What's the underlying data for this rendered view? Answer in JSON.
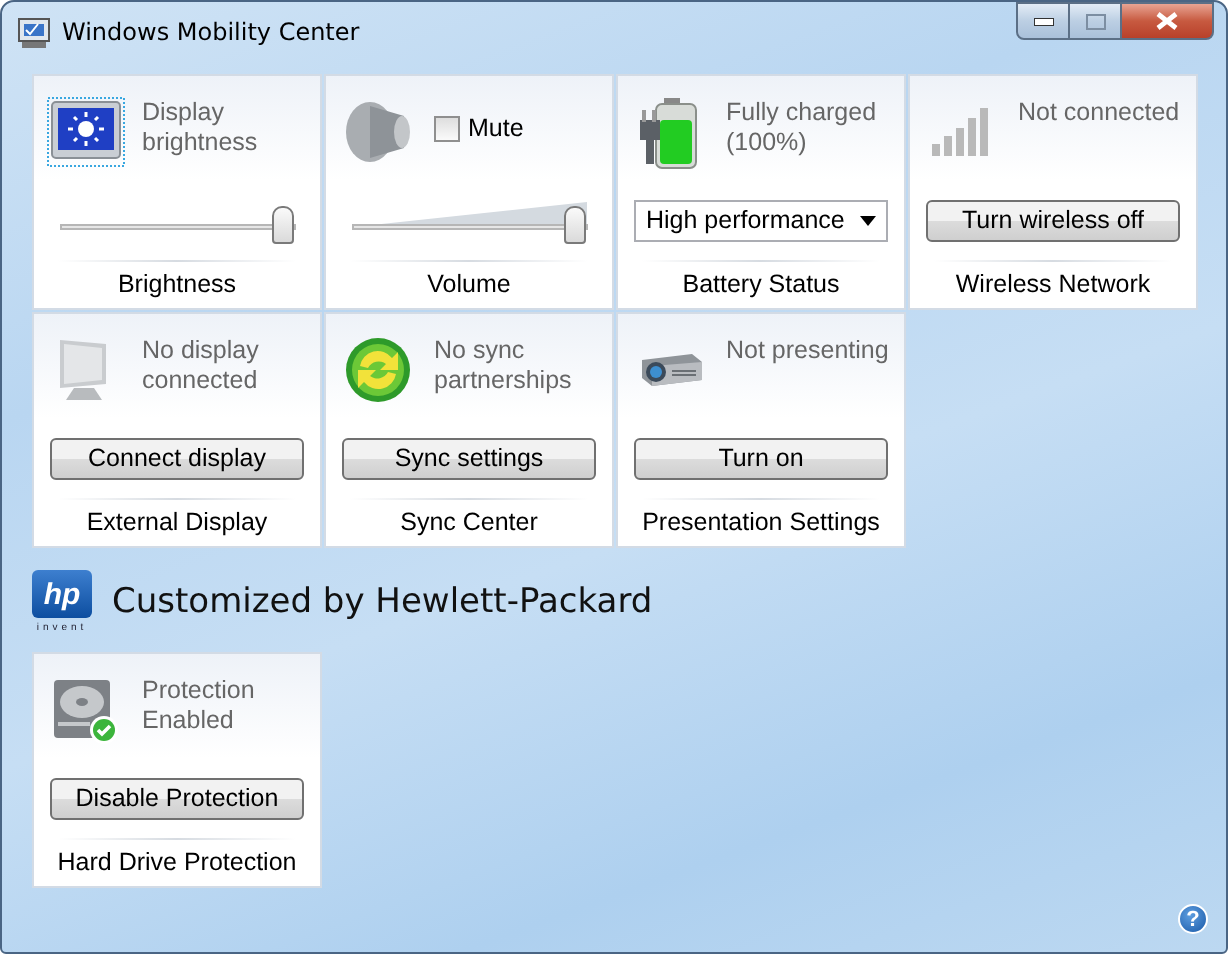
{
  "window": {
    "title": "Windows Mobility Center"
  },
  "tiles": [
    {
      "status": "Display brightness",
      "kind": "slider",
      "level": 1.0,
      "title": "Brightness"
    },
    {
      "kind": "volume",
      "mute": {
        "label": "Mute",
        "checked": false
      },
      "level": 1.0,
      "title": "Volume"
    },
    {
      "status": "Fully charged (100%)",
      "kind": "dropdown",
      "value": "High performance",
      "title": "Battery Status"
    },
    {
      "status": "Not connected",
      "kind": "button",
      "button": "Turn wireless off",
      "title": "Wireless Network"
    },
    {
      "status": "No display connected",
      "kind": "button",
      "button": "Connect display",
      "title": "External Display"
    },
    {
      "status": "No sync partnerships",
      "kind": "button",
      "button": "Sync settings",
      "title": "Sync Center"
    },
    {
      "status": "Not presenting",
      "kind": "button",
      "button": "Turn on",
      "title": "Presentation Settings"
    }
  ],
  "oem": {
    "logo": "hp",
    "tagline": "invent",
    "title": "Customized by Hewlett-Packard",
    "tiles": [
      {
        "status": "Protection Enabled",
        "kind": "button",
        "button": "Disable Protection",
        "title": "Hard Drive Protection"
      }
    ]
  },
  "help": "?"
}
